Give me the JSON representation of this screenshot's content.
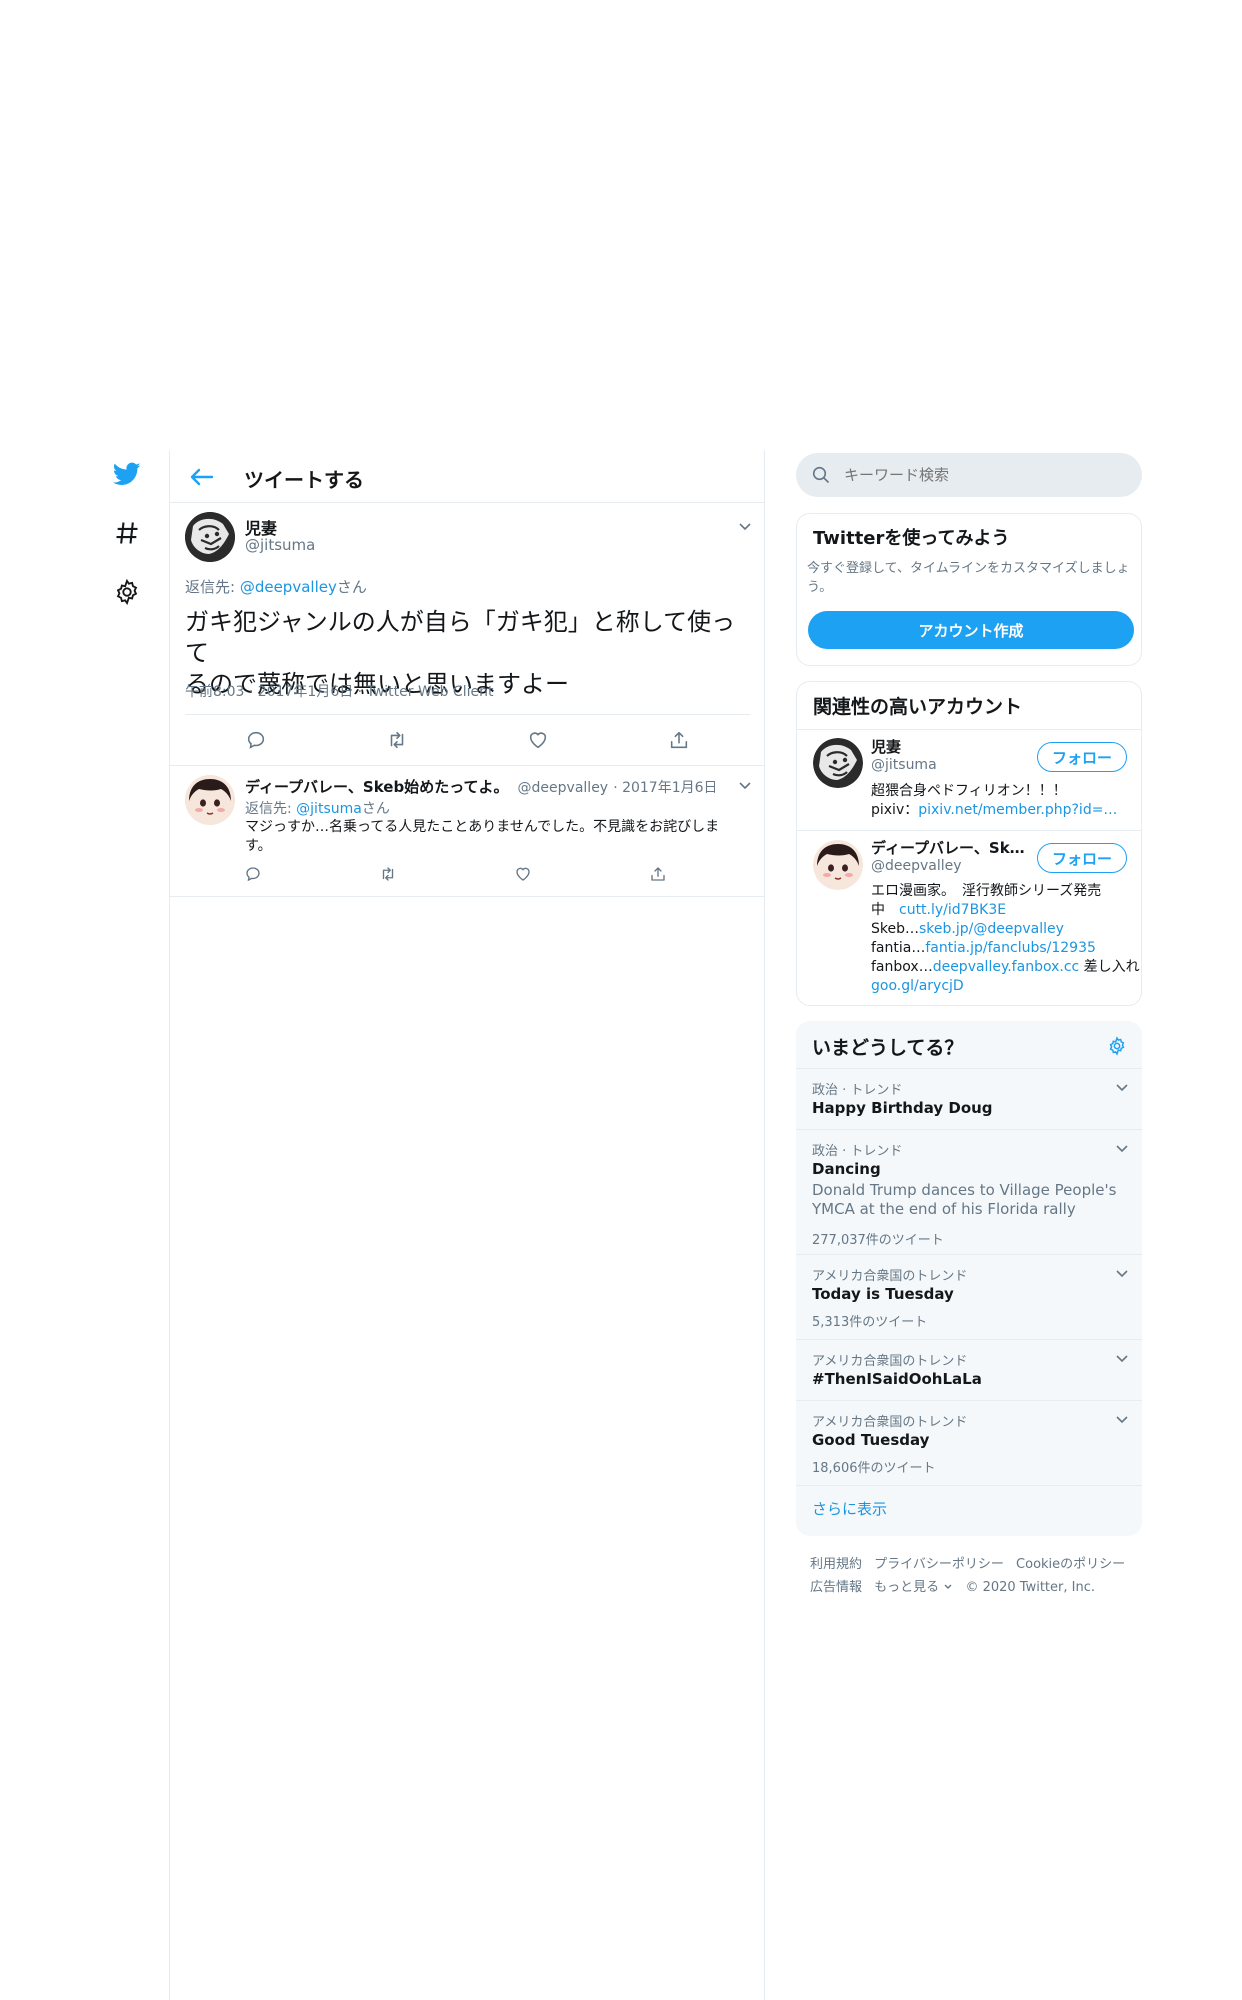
{
  "nav": {
    "icons": [
      "twitter-bird-icon",
      "hashtag-icon",
      "settings-icon"
    ]
  },
  "header": {
    "title": "ツイートする"
  },
  "main_tweet": {
    "name": "児妻",
    "handle": "@jitsuma",
    "reply_prefix": "返信先: ",
    "reply_to": "@deepvalley",
    "reply_suffix": "さん",
    "text_line1": "ガキ犯ジャンルの人が自ら「ガキ犯」と称して使って",
    "text_line2": "るので蔑称では無いと思いますよー",
    "meta": "午前8:03 · 2017年1月6日 · Twitter Web Client"
  },
  "reply": {
    "name": "ディープバレー、Skeb始めたってよ。",
    "handle": "@deepvalley",
    "date": "· 2017年1月6日",
    "reply_prefix": "返信先: ",
    "reply_to": "@jitsuma",
    "reply_suffix": "さん",
    "text_line1": "マジっすか…名乗ってる人見たことありませんでした。不見識をお詫びしま",
    "text_line2": "す。"
  },
  "search": {
    "placeholder": "キーワード検索"
  },
  "signup": {
    "title": "Twitterを使ってみよう",
    "desc_line1": "今すぐ登録して、タイムラインをカスタマイズしましょ",
    "desc_line2": "う。",
    "button": "アカウント作成"
  },
  "related": {
    "title": "関連性の高いアカウント",
    "accounts": [
      {
        "name": "児妻",
        "handle": "@jitsuma",
        "follow": "フォロー",
        "bio_line1": "超猥合身ペドフィリオン！！！",
        "bio_line2_prefix": "pixiv：",
        "bio_line2_link": "pixiv.net/member.php?id=…"
      },
      {
        "name": "ディープバレー、Sk…",
        "handle": "@deepvalley",
        "follow": "フォロー",
        "bio_line1": "エロ漫画家。　淫行教師シリーズ発売",
        "bio_line2_prefix": "中　",
        "bio_line2_link": "cutt.ly/id7BK3E",
        "bio_line3_prefix": "Skeb…",
        "bio_line3_link": "skeb.jp/@deepvalley",
        "bio_line4_prefix": "fantia…",
        "bio_line4_link": "fantia.jp/fanclubs/12935",
        "bio_line5_prefix": "fanbox…",
        "bio_line5_link": "deepvalley.fanbox.cc",
        "bio_line5_suffix": " 差し入れ",
        "bio_line6_link": "goo.gl/arycjD"
      }
    ]
  },
  "trends": {
    "title": "いまどうしてる？",
    "items": [
      {
        "category": "政治 · トレンド",
        "name": "Happy Birthday Doug"
      },
      {
        "category": "政治 · トレンド",
        "name": "Dancing",
        "desc_line1": "Donald Trump dances to Village People's",
        "desc_line2": "YMCA at the end of his Florida rally",
        "count": "277,037件のツイート"
      },
      {
        "category": "アメリカ合衆国のトレンド",
        "name": "Today is Tuesday",
        "count": "5,313件のツイート"
      },
      {
        "category": "アメリカ合衆国のトレンド",
        "name": "#ThenISaidOohLaLa"
      },
      {
        "category": "アメリカ合衆国のトレンド",
        "name": "Good Tuesday",
        "count": "18,606件のツイート"
      }
    ],
    "show_more": "さらに表示"
  },
  "footer": {
    "terms": "利用規約",
    "privacy": "プライバシーポリシー",
    "cookie": "Cookieのポリシー",
    "ads": "広告情報",
    "more": "もっと見る",
    "copyright": "© 2020 Twitter, Inc."
  },
  "colors": {
    "accent": "#1da1f2",
    "link": "#1b95e0",
    "text": "#14171a",
    "muted": "#657786",
    "border": "#e6ecf0"
  }
}
